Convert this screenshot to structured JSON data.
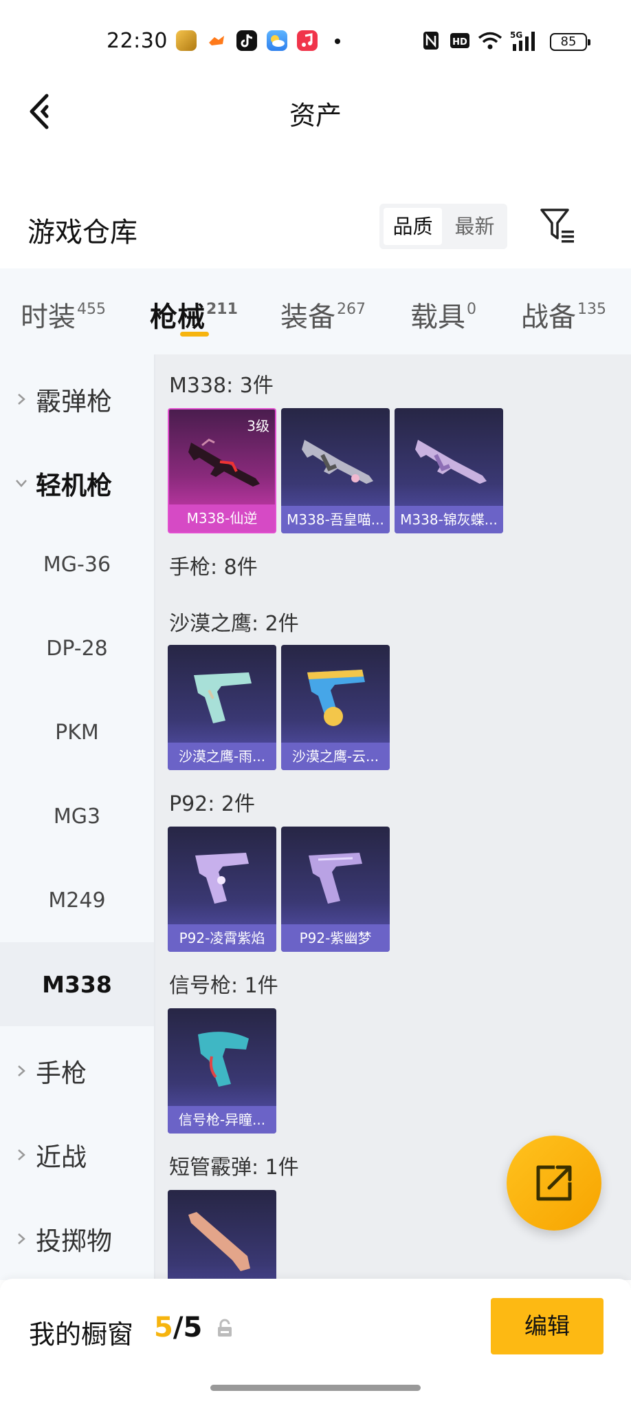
{
  "status_bar": {
    "time": "22:30",
    "battery": "85",
    "network": "5G"
  },
  "header": {
    "title": "资产",
    "back_icon": "chevron-left-icon"
  },
  "warehouse": {
    "title": "游戏仓库",
    "sort_options": [
      "品质",
      "最新"
    ],
    "selected_sort": "品质",
    "filter_icon": "filter-icon"
  },
  "tabs": [
    {
      "label": "时装",
      "count": "455"
    },
    {
      "label": "枪械",
      "count": "211",
      "active": true
    },
    {
      "label": "装备",
      "count": "267"
    },
    {
      "label": "载具",
      "count": "0"
    },
    {
      "label": "战备",
      "count": "135"
    }
  ],
  "sidebar": {
    "items": [
      {
        "label": "霰弹枪",
        "type": "category",
        "expanded": false
      },
      {
        "label": "轻机枪",
        "type": "category",
        "expanded": true
      },
      {
        "label": "MG-36",
        "type": "sub"
      },
      {
        "label": "DP-28",
        "type": "sub"
      },
      {
        "label": "PKM",
        "type": "sub"
      },
      {
        "label": "MG3",
        "type": "sub"
      },
      {
        "label": "M249",
        "type": "sub"
      },
      {
        "label": "M338",
        "type": "sub",
        "selected": true
      },
      {
        "label": "手枪",
        "type": "category",
        "expanded": false
      },
      {
        "label": "近战",
        "type": "category",
        "expanded": false
      },
      {
        "label": "投掷物",
        "type": "category",
        "expanded": false
      }
    ]
  },
  "groups": [
    {
      "title": "M338: 3件",
      "items": [
        {
          "name": "M338-仙逆",
          "level": "3级",
          "style": "pink"
        },
        {
          "name": "M338-吾皇喵...",
          "style": "purple"
        },
        {
          "name": "M338-锦灰蝶...",
          "style": "purple"
        }
      ]
    },
    {
      "title": "手枪: 8件",
      "items": []
    },
    {
      "title": "沙漠之鹰: 2件",
      "items": [
        {
          "name": "沙漠之鹰-雨...",
          "style": "purple"
        },
        {
          "name": "沙漠之鹰-云...",
          "style": "purple"
        }
      ]
    },
    {
      "title": "P92: 2件",
      "items": [
        {
          "name": "P92-凌霄紫焰",
          "style": "purple"
        },
        {
          "name": "P92-紫幽梦",
          "style": "purple"
        }
      ]
    },
    {
      "title": "信号枪: 1件",
      "items": [
        {
          "name": "信号枪-异瞳...",
          "style": "purple"
        }
      ]
    },
    {
      "title": "短管霰弹: 1件",
      "items": [
        {
          "name": "",
          "style": "purple"
        }
      ]
    }
  ],
  "fab": {
    "icon": "share-icon"
  },
  "showcase": {
    "label": "我的橱窗",
    "current": "5",
    "total": "/5",
    "lock_icon": "lock-icon",
    "edit_label": "编辑"
  },
  "colors": {
    "accent": "#f6b40f",
    "card_purple": "#6b63c7",
    "card_pink": "#d64ac5"
  }
}
